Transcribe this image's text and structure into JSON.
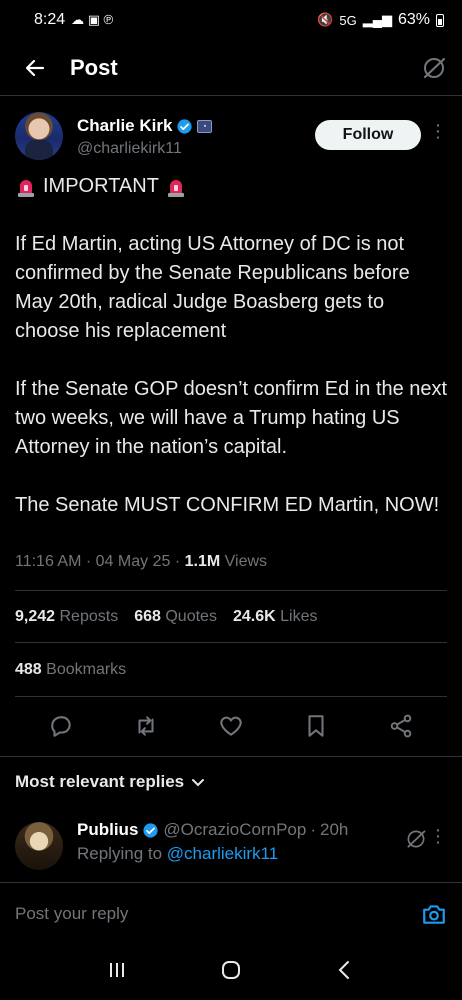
{
  "status_bar": {
    "time": "8:24",
    "network": "5G",
    "battery": "63%"
  },
  "header": {
    "title": "Post"
  },
  "author": {
    "name": "Charlie Kirk",
    "handle": "@charliekirk11",
    "follow_label": "Follow"
  },
  "tweet": {
    "headline": "IMPORTANT",
    "para1": "If Ed Martin, acting US Attorney of DC is not confirmed by the Senate Republicans before May 20th, radical Judge Boasberg gets to choose his replacement",
    "para2": "If the Senate GOP doesn’t confirm Ed in the next two weeks, we will have a Trump hating US Attorney in the nation’s capital.",
    "para3": "The Senate MUST CONFIRM ED Martin, NOW!"
  },
  "meta": {
    "time": "11:16 AM",
    "date": "04 May 25",
    "views_count": "1.1M",
    "views_label": "Views"
  },
  "stats": {
    "reposts_count": "9,242",
    "reposts_label": "Reposts",
    "quotes_count": "668",
    "quotes_label": "Quotes",
    "likes_count": "24.6K",
    "likes_label": "Likes",
    "bookmarks_count": "488",
    "bookmarks_label": "Bookmarks"
  },
  "replies_section": {
    "sort_label": "Most relevant replies"
  },
  "reply": {
    "name": "Publius",
    "handle": "@OcrazioCornPop",
    "age": "20h",
    "replying_prefix": "Replying to",
    "replying_to": "@charliekirk11"
  },
  "composer": {
    "placeholder": "Post your reply"
  },
  "colors": {
    "accent": "#1d9bf0",
    "background": "#000000",
    "text": "#e7e9ea",
    "muted": "#71767b"
  }
}
